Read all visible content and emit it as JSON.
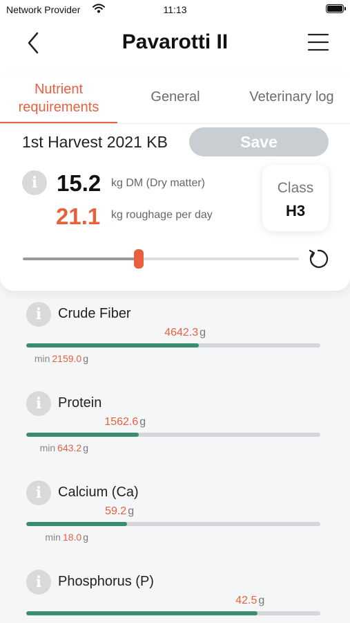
{
  "status_bar": {
    "carrier": "Network Provider",
    "time": "11:13",
    "icons": [
      "wifi-icon",
      "battery-icon"
    ]
  },
  "header": {
    "title": "Pavarotti II",
    "back_icon": "chevron-left-icon",
    "menu_icon": "hamburger-menu-icon"
  },
  "tabs": [
    {
      "label": "Nutrient requirements",
      "active": true
    },
    {
      "label": "General",
      "active": false
    },
    {
      "label": "Veterinary log",
      "active": false
    }
  ],
  "harvest": {
    "name": "1st Harvest 2021 KB",
    "save_label": "Save"
  },
  "summary": {
    "dm_value": "15.2",
    "dm_unit": "kg DM (Dry matter)",
    "roughage_value": "21.1",
    "roughage_unit": "kg roughage per day",
    "class_label": "Class",
    "class_value": "H3",
    "slider_level": 0.42
  },
  "nutrients": [
    {
      "name": "Crude Fiber",
      "value": "4642.3",
      "unit": "g",
      "min_label": "min",
      "min": "2159.0",
      "min_unit": "g",
      "fill": 0.587
    },
    {
      "name": "Protein",
      "value": "1562.6",
      "unit": "g",
      "min_label": "min",
      "min": "643.2",
      "min_unit": "g",
      "fill": 0.383
    },
    {
      "name": "Calcium (Ca)",
      "value": "59.2",
      "unit": "g",
      "min_label": "min",
      "min": "18.0",
      "min_unit": "g",
      "fill": 0.343
    },
    {
      "name": "Phosphorus (P)",
      "value": "42.5",
      "unit": "g",
      "min_label": "",
      "min": "",
      "min_unit": "",
      "fill": 0.787
    }
  ],
  "colors": {
    "accent": "#e8603c",
    "progress": "#3a8d6f",
    "save_disabled": "#c9ced3"
  }
}
